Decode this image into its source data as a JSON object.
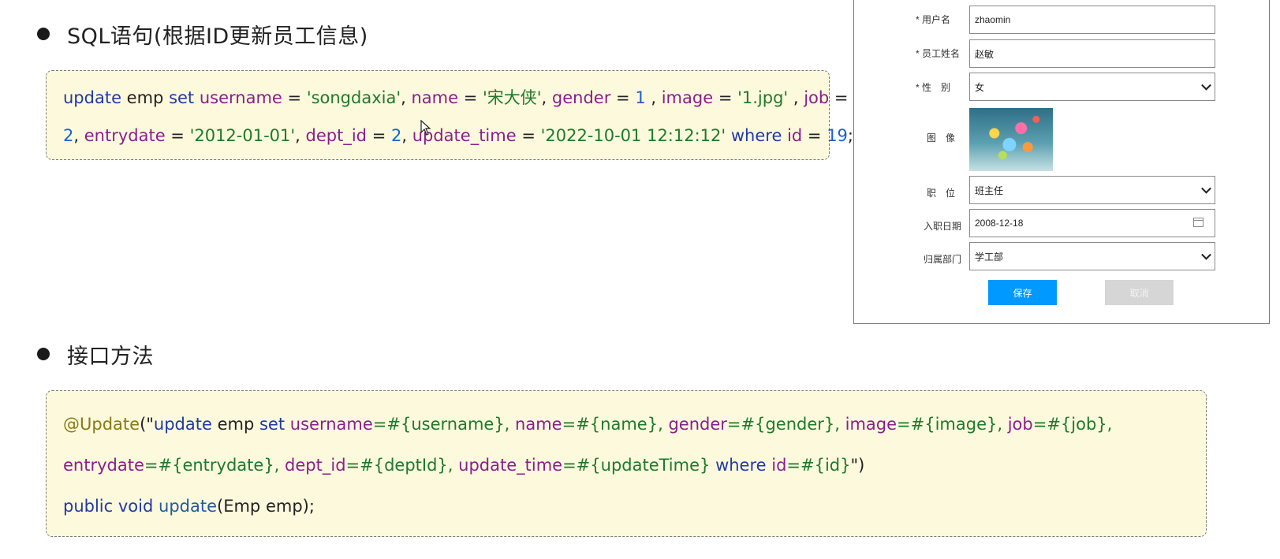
{
  "sql_section": {
    "heading": "SQL语句(根据ID更新员工信息)",
    "code_lines": [
      [
        {
          "t": "update",
          "c": "kw"
        },
        {
          "t": " emp ",
          "c": "plain"
        },
        {
          "t": "set",
          "c": "kw"
        },
        {
          "t": " ",
          "c": "plain"
        },
        {
          "t": "username",
          "c": "col"
        },
        {
          "t": " = ",
          "c": "plain"
        },
        {
          "t": "'songdaxia'",
          "c": "str"
        },
        {
          "t": ", ",
          "c": "plain"
        },
        {
          "t": "name",
          "c": "col"
        },
        {
          "t": " = ",
          "c": "plain"
        },
        {
          "t": "'宋大侠'",
          "c": "str"
        },
        {
          "t": ", ",
          "c": "plain"
        },
        {
          "t": "gender",
          "c": "col"
        },
        {
          "t": " = ",
          "c": "plain"
        },
        {
          "t": "1",
          "c": "num"
        },
        {
          "t": " , ",
          "c": "plain"
        },
        {
          "t": "image",
          "c": "col"
        },
        {
          "t": " = ",
          "c": "plain"
        },
        {
          "t": "'1.jpg'",
          "c": "str"
        },
        {
          "t": " , ",
          "c": "plain"
        },
        {
          "t": "job",
          "c": "col"
        },
        {
          "t": " =",
          "c": "plain"
        }
      ],
      [
        {
          "t": "2",
          "c": "num"
        },
        {
          "t": ", ",
          "c": "plain"
        },
        {
          "t": "entrydate",
          "c": "col"
        },
        {
          "t": " = ",
          "c": "plain"
        },
        {
          "t": "'2012-01-01'",
          "c": "str"
        },
        {
          "t": ", ",
          "c": "plain"
        },
        {
          "t": "dept_id",
          "c": "col"
        },
        {
          "t": " = ",
          "c": "plain"
        },
        {
          "t": "2",
          "c": "num"
        },
        {
          "t": ", ",
          "c": "plain"
        },
        {
          "t": "update_time",
          "c": "col"
        },
        {
          "t": " = ",
          "c": "plain"
        },
        {
          "t": "'2022-10-01 12:12:12'",
          "c": "str"
        },
        {
          "t": " ",
          "c": "plain"
        },
        {
          "t": "where",
          "c": "kw"
        },
        {
          "t": " ",
          "c": "plain"
        },
        {
          "t": "id",
          "c": "col"
        },
        {
          "t": " = ",
          "c": "plain"
        },
        {
          "t": "19",
          "c": "num"
        },
        {
          "t": ";",
          "c": "plain"
        }
      ]
    ]
  },
  "api_section": {
    "heading": "接口方法",
    "code_lines": [
      [
        {
          "t": "@Update",
          "c": "ann"
        },
        {
          "t": "(\"",
          "c": "plain"
        },
        {
          "t": "update",
          "c": "kw"
        },
        {
          "t": " emp ",
          "c": "plain"
        },
        {
          "t": "set",
          "c": "kw"
        },
        {
          "t": " ",
          "c": "plain"
        },
        {
          "t": "username",
          "c": "col"
        },
        {
          "t": "=#{username}, ",
          "c": "str"
        },
        {
          "t": "name",
          "c": "col"
        },
        {
          "t": "=#{name}, ",
          "c": "str"
        },
        {
          "t": "gender",
          "c": "col"
        },
        {
          "t": "=#{gender}, ",
          "c": "str"
        },
        {
          "t": "image",
          "c": "col"
        },
        {
          "t": "=#{image}, ",
          "c": "str"
        },
        {
          "t": "job",
          "c": "col"
        },
        {
          "t": "=#{job},",
          "c": "str"
        }
      ],
      [
        {
          "t": "entrydate",
          "c": "col"
        },
        {
          "t": "=#{entrydate}, ",
          "c": "str"
        },
        {
          "t": "dept_id",
          "c": "col"
        },
        {
          "t": "=#{deptId}, ",
          "c": "str"
        },
        {
          "t": "update_time",
          "c": "col"
        },
        {
          "t": "=#{updateTime} ",
          "c": "str"
        },
        {
          "t": "where",
          "c": "kw"
        },
        {
          "t": " ",
          "c": "plain"
        },
        {
          "t": "id",
          "c": "col"
        },
        {
          "t": "=#{id}",
          "c": "str"
        },
        {
          "t": "\")",
          "c": "plain"
        }
      ],
      [
        {
          "t": "public",
          "c": "kw"
        },
        {
          "t": " ",
          "c": "plain"
        },
        {
          "t": "void",
          "c": "kw"
        },
        {
          "t": " ",
          "c": "plain"
        },
        {
          "t": "update",
          "c": "fn"
        },
        {
          "t": "(Emp emp);",
          "c": "plain"
        }
      ]
    ]
  },
  "form": {
    "username_label": "* 用户名",
    "username_value": "zhaomin",
    "name_label": "* 员工姓名",
    "name_value": "赵敏",
    "gender_label": "* 性　别",
    "gender_value": "女",
    "image_label": "图　像",
    "job_label": "职　位",
    "job_value": "班主任",
    "entrydate_label": "入职日期",
    "entrydate_value": "2008-12-18",
    "dept_label": "归属部门",
    "dept_value": "学工部",
    "save_label": "保存",
    "cancel_label": "取消"
  },
  "colors": {
    "code_bg": "#fdf9dd",
    "keyword": "#1f3aa6",
    "column": "#8a1e8c",
    "string": "#1e7a2a",
    "number": "#1f5fd0",
    "annotation": "#8a7a10",
    "save_button": "#0099ff",
    "cancel_button": "#d6d6d6"
  }
}
